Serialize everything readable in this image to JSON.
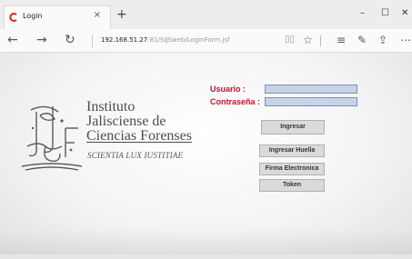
{
  "browser": {
    "tab_title": "Login",
    "tab_close": "×",
    "new_tab": "+",
    "url_host": "192.168.51.27",
    "url_path": ":81/SIJSweb/LoginForm.jsf",
    "back_glyph": "←",
    "forward_glyph": "→",
    "refresh_glyph": "↻",
    "minimize_glyph": "–",
    "maximize_glyph": "☐",
    "close_glyph": "✕",
    "reading_view_glyph": "📖",
    "favorite_glyph": "☆",
    "hub_glyph": "≡",
    "notes_glyph": "✎",
    "share_glyph": "⇪",
    "more_glyph": "⋯",
    "icons": [
      "tab-favicon-icon",
      "back-icon",
      "forward-icon",
      "refresh-icon",
      "reading-view-icon",
      "favorite-star-icon",
      "hub-icon",
      "web-note-icon",
      "share-icon",
      "more-icon"
    ]
  },
  "institution": {
    "line1": "Instituto",
    "line2": "Jalisciense de",
    "line3": "Ciencias Forenses",
    "motto": "SCIENTIA LUX IUSTITIAE"
  },
  "login": {
    "user_label": "Usuario :",
    "password_label": "Contraseña :",
    "user_value": "",
    "password_value": "",
    "label_color": "#c8102e",
    "field_color": "#c7d3e6"
  },
  "buttons": {
    "login": "Ingresar",
    "fingerprint": "Ingresar Huella",
    "e_signature": "Firma Electronica",
    "token": "Token"
  }
}
